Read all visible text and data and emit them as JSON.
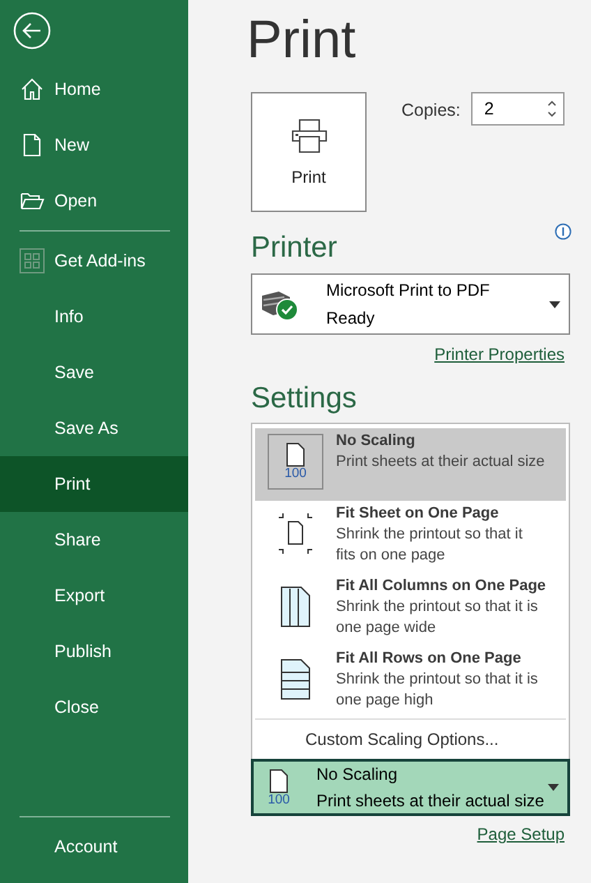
{
  "sidebar": {
    "groups": [
      [
        {
          "label": "Home",
          "kind": "home",
          "selected": false
        },
        {
          "label": "New",
          "kind": "file",
          "selected": false
        },
        {
          "label": "Open",
          "kind": "folder",
          "selected": false
        }
      ],
      [
        {
          "label": "Get Add-ins",
          "kind": "grid",
          "selected": false
        },
        {
          "label": "Info",
          "kind": "plain",
          "selected": false
        },
        {
          "label": "Save",
          "kind": "plain",
          "selected": false
        },
        {
          "label": "Save As",
          "kind": "plain",
          "selected": false
        },
        {
          "label": "Print",
          "kind": "plain",
          "selected": true
        },
        {
          "label": "Share",
          "kind": "plain",
          "selected": false
        },
        {
          "label": "Export",
          "kind": "plain",
          "selected": false
        },
        {
          "label": "Publish",
          "kind": "plain",
          "selected": false
        },
        {
          "label": "Close",
          "kind": "plain",
          "selected": false
        }
      ],
      [
        {
          "label": "Account",
          "kind": "plain",
          "selected": false
        }
      ]
    ]
  },
  "title": "Print",
  "print_button": {
    "label": "Print"
  },
  "copies": {
    "label": "Copies:",
    "value": "2"
  },
  "printer": {
    "heading": "Printer",
    "name": "Microsoft Print to PDF",
    "status": "Ready",
    "link": "Printer Properties"
  },
  "settings": {
    "heading": "Settings",
    "options": [
      {
        "kind": "none",
        "icon_label": "100",
        "title": "No Scaling",
        "description": "Print sheets at their actual size",
        "selected": true
      },
      {
        "kind": "sheet",
        "title": "Fit Sheet on One Page",
        "description": "Shrink the printout so that it fits on one page",
        "selected": false
      },
      {
        "kind": "columns",
        "title": "Fit All Columns on One Page",
        "description": "Shrink the printout so that it is one page wide",
        "selected": false
      },
      {
        "kind": "rows",
        "title": "Fit All Rows on One Page",
        "description": "Shrink the printout so that it is one page high",
        "selected": false
      }
    ],
    "custom": "Custom Scaling Options...",
    "current": {
      "icon_label": "100",
      "title": "No Scaling",
      "description": "Print sheets at their actual size"
    },
    "link": "Page Setup"
  }
}
